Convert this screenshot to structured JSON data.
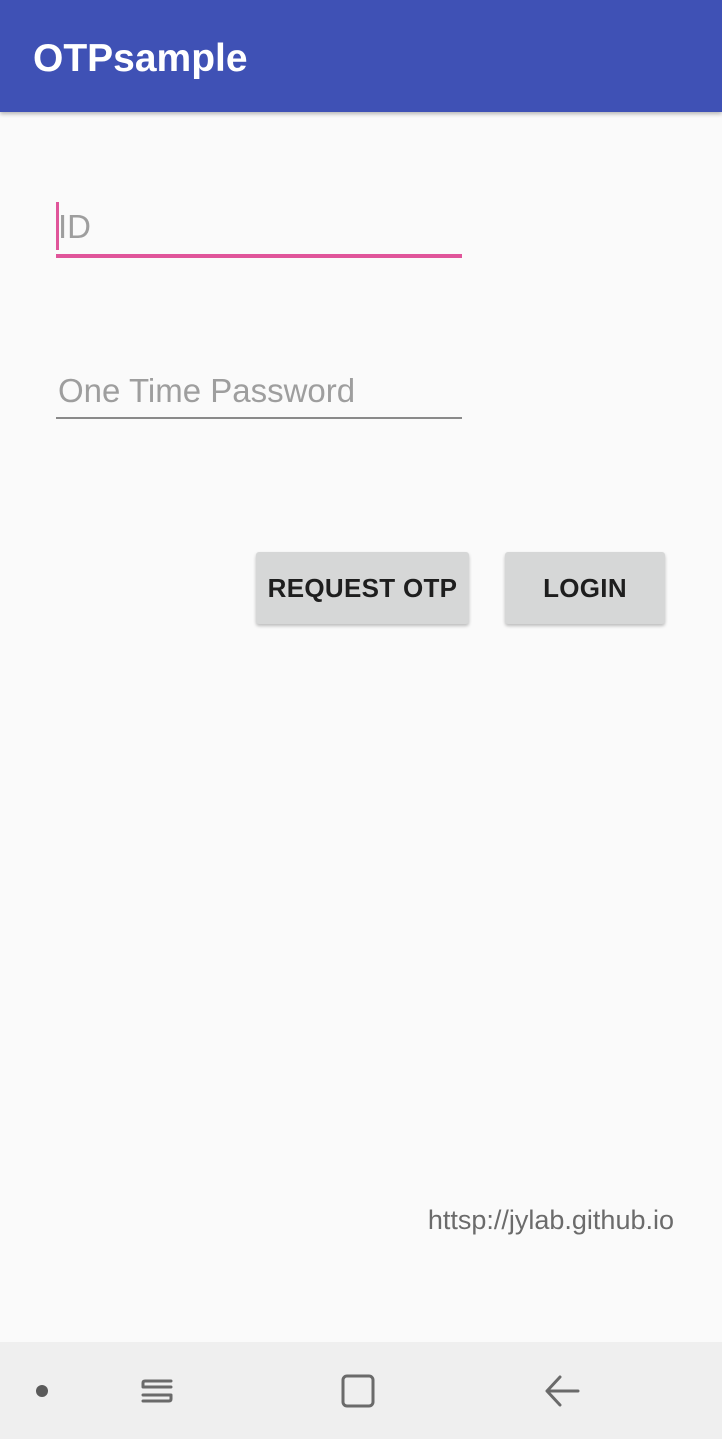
{
  "app_bar": {
    "title": "OTPsample"
  },
  "form": {
    "id_placeholder": "ID",
    "otp_placeholder": "One Time Password"
  },
  "buttons": {
    "request_otp": "REQUEST OTP",
    "login": "LOGIN"
  },
  "footer": {
    "link": "httsp://jylab.github.io"
  },
  "nav": {
    "icons": [
      "dot-icon",
      "recent-apps-icon",
      "home-icon",
      "back-icon"
    ]
  },
  "colors": {
    "primary": "#3f51b5",
    "accent": "#e0559a",
    "button_bg": "#d6d7d7",
    "background": "#fafafa"
  }
}
